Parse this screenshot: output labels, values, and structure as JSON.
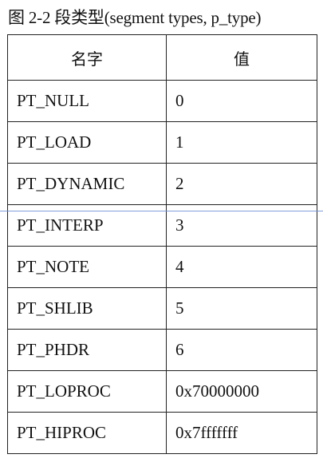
{
  "caption": "图 2-2 段类型(segment types, p_type)",
  "table": {
    "headers": [
      "名字",
      "值"
    ],
    "rows": [
      {
        "name": "PT_NULL",
        "value": "0"
      },
      {
        "name": "PT_LOAD",
        "value": "1"
      },
      {
        "name": "PT_DYNAMIC",
        "value": "2"
      },
      {
        "name": "PT_INTERP",
        "value": "3"
      },
      {
        "name": "PT_NOTE",
        "value": "4"
      },
      {
        "name": "PT_SHLIB",
        "value": "5"
      },
      {
        "name": "PT_PHDR",
        "value": "6"
      },
      {
        "name": "PT_LOPROC",
        "value": "0x70000000"
      },
      {
        "name": "PT_HIPROC",
        "value": "0x7fffffff"
      }
    ]
  },
  "colors": {
    "guide_line": "#6f8fd6",
    "border": "#222222"
  }
}
